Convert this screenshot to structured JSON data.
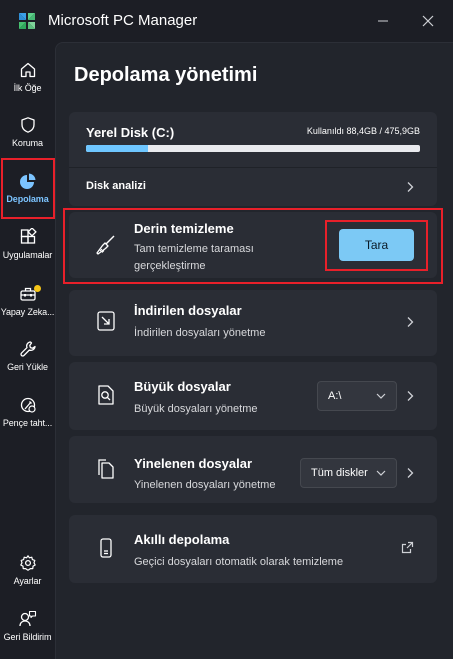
{
  "app": {
    "title": "Microsoft PC Manager"
  },
  "sidebar": {
    "items": [
      {
        "label": "İlk Öğe",
        "icon": "home-icon"
      },
      {
        "label": "Koruma",
        "icon": "shield-icon"
      },
      {
        "label": "Depolama",
        "icon": "pie-chart-icon",
        "active": true
      },
      {
        "label": "Uygulamalar",
        "icon": "apps-icon"
      },
      {
        "label": "Yapay Zeka...",
        "icon": "toolbox-icon",
        "badge": true
      },
      {
        "label": "Geri Yükle",
        "icon": "wrench-icon"
      },
      {
        "label": "Pençe taht...",
        "icon": "pen-tablet-icon"
      }
    ],
    "bottom": [
      {
        "label": "Ayarlar",
        "icon": "gear-icon"
      },
      {
        "label": "Geri Bildirim",
        "icon": "feedback-icon"
      }
    ]
  },
  "page": {
    "title": "Depolama yönetimi"
  },
  "disk": {
    "name": "Yerel Disk (C:)",
    "usage": "Kullanıldı 88,4GB / 475,9GB",
    "used_fraction": 0.186,
    "analysis_label": "Disk analizi"
  },
  "rows": {
    "deep_clean": {
      "title": "Derin temizleme",
      "desc1": "Tam temizleme taraması",
      "desc2": "gerçekleştirme",
      "button": "Tara"
    },
    "downloads": {
      "title": "İndirilen dosyalar",
      "desc": "İndirilen dosyaları yönetme"
    },
    "large_files": {
      "title": "Büyük dosyalar",
      "desc": "Büyük dosyaları yönetme",
      "select": "A:\\"
    },
    "duplicates": {
      "title": "Yinelenen dosyalar",
      "desc": "Yinelenen dosyaları yönetme",
      "select": "Tüm diskler"
    },
    "smart_storage": {
      "title": "Akıllı depolama",
      "desc": "Geçici dosyaları otomatik olarak temizleme"
    }
  },
  "colors": {
    "accent": "#6ec6ff",
    "highlight": "#e8202a",
    "background": "#1c1e25",
    "card": "#2a2d35"
  }
}
